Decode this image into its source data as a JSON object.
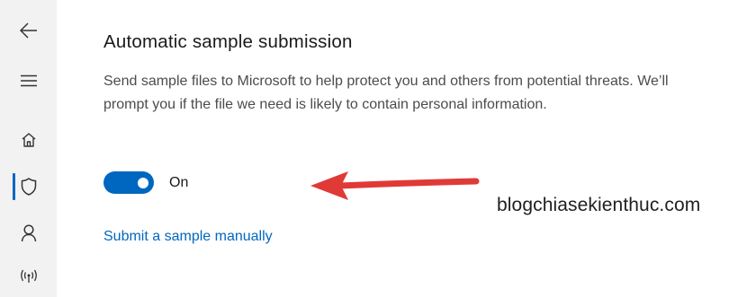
{
  "sidebar": {
    "items": [
      {
        "name": "back",
        "icon": "back-arrow-icon"
      },
      {
        "name": "menu",
        "icon": "hamburger-menu-icon"
      },
      {
        "name": "home",
        "icon": "home-icon"
      },
      {
        "name": "virus-protection",
        "icon": "shield-icon",
        "active": true
      },
      {
        "name": "account-protection",
        "icon": "person-icon"
      },
      {
        "name": "firewall",
        "icon": "wifi-antenna-icon"
      }
    ]
  },
  "section": {
    "title": "Automatic sample submission",
    "description": "Send sample files to Microsoft to help protect you and others from potential threats. We’ll prompt you if the file we need is likely to contain personal information.",
    "toggle_state": "On",
    "toggle_on": true,
    "link": "Submit a sample manually"
  },
  "annotation": {
    "arrow_color": "#e03a37",
    "watermark": "blogchiasekienthuc.com"
  },
  "colors": {
    "accent": "#0067c0",
    "sidebar_bg": "#f2f2f2"
  }
}
